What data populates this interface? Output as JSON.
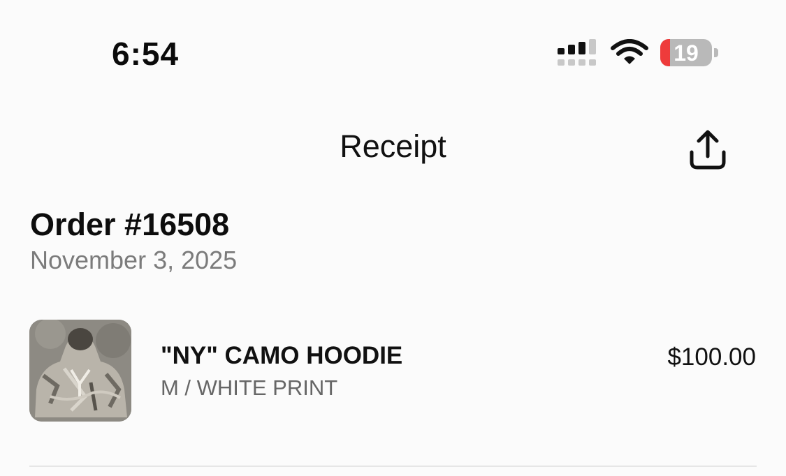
{
  "status_bar": {
    "time": "6:54",
    "battery_level": "19",
    "battery_fraction": 0.19,
    "battery_color": "#ee3b3b",
    "icons": [
      "signal-icon",
      "wifi-icon",
      "battery-icon"
    ]
  },
  "nav": {
    "title": "Receipt",
    "share_icon": "share-icon"
  },
  "order": {
    "title": "Order #16508",
    "date": "November 3, 2025"
  },
  "items": [
    {
      "name": "\"NY\" CAMO HOODIE",
      "variant": "M / WHITE PRINT",
      "price": "$100.00"
    }
  ]
}
